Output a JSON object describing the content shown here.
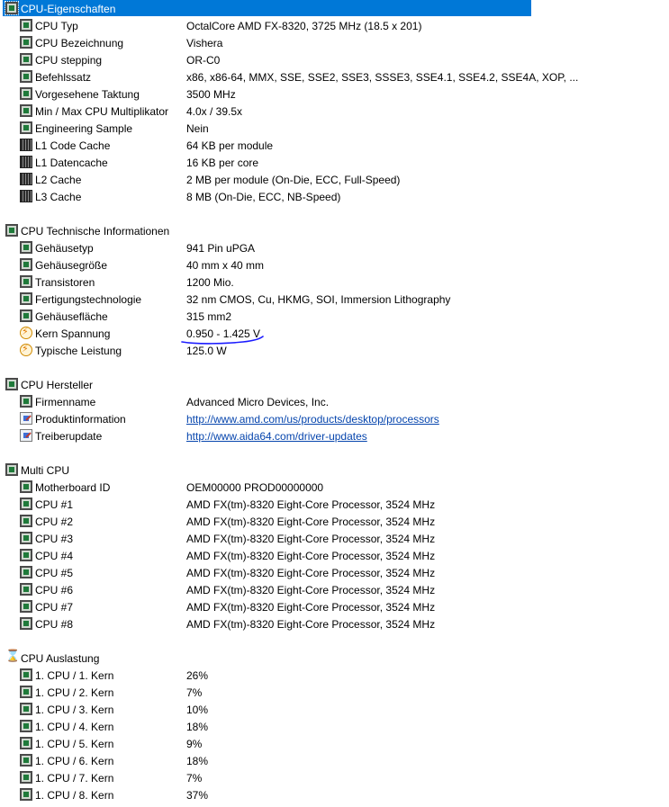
{
  "rows": [
    {
      "type": "section",
      "icon": "chip",
      "label": "CPU-Eigenschaften",
      "value": "",
      "selected": true,
      "name": "section-cpu-eigenschaften"
    },
    {
      "type": "item",
      "icon": "chip",
      "label": "CPU Typ",
      "value": "OctalCore AMD FX-8320, 3725 MHz (18.5 x 201)",
      "name": "row-cpu-typ"
    },
    {
      "type": "item",
      "icon": "chip",
      "label": "CPU Bezeichnung",
      "value": "Vishera",
      "name": "row-cpu-bezeichnung"
    },
    {
      "type": "item",
      "icon": "chip",
      "label": "CPU stepping",
      "value": "OR-C0",
      "name": "row-cpu-stepping"
    },
    {
      "type": "item",
      "icon": "chip",
      "label": "Befehlssatz",
      "value": "x86, x86-64, MMX, SSE, SSE2, SSE3, SSSE3, SSE4.1, SSE4.2, SSE4A, XOP, ...",
      "name": "row-befehlssatz"
    },
    {
      "type": "item",
      "icon": "chip",
      "label": "Vorgesehene Taktung",
      "value": "3500 MHz",
      "name": "row-vorgesehene-taktung"
    },
    {
      "type": "item",
      "icon": "chip",
      "label": "Min / Max CPU Multiplikator",
      "value": "4.0x / 39.5x",
      "name": "row-multiplikator"
    },
    {
      "type": "item",
      "icon": "chip",
      "label": "Engineering Sample",
      "value": "Nein",
      "name": "row-engineering-sample"
    },
    {
      "type": "item",
      "icon": "memory",
      "label": "L1 Code Cache",
      "value": "64 KB per module",
      "name": "row-l1-code-cache"
    },
    {
      "type": "item",
      "icon": "memory",
      "label": "L1 Datencache",
      "value": "16 KB per core",
      "name": "row-l1-datencache"
    },
    {
      "type": "item",
      "icon": "memory",
      "label": "L2 Cache",
      "value": "2 MB per module  (On-Die, ECC, Full-Speed)",
      "name": "row-l2-cache"
    },
    {
      "type": "item",
      "icon": "memory",
      "label": "L3 Cache",
      "value": "8 MB  (On-Die, ECC, NB-Speed)",
      "name": "row-l3-cache"
    },
    {
      "type": "blank"
    },
    {
      "type": "section",
      "icon": "chip",
      "label": "CPU Technische Informationen",
      "value": "",
      "name": "section-cpu-technische-informationen"
    },
    {
      "type": "item",
      "icon": "chip",
      "label": "Gehäusetyp",
      "value": "941 Pin uPGA",
      "name": "row-gehaeusetyp"
    },
    {
      "type": "item",
      "icon": "chip",
      "label": "Gehäusegröße",
      "value": "40 mm x 40 mm",
      "name": "row-gehaeusegroesse"
    },
    {
      "type": "item",
      "icon": "chip",
      "label": "Transistoren",
      "value": "1200 Mio.",
      "name": "row-transistoren"
    },
    {
      "type": "item",
      "icon": "chip",
      "label": "Fertigungstechnologie",
      "value": "32 nm CMOS, Cu, HKMG, SOI, Immersion Lithography",
      "name": "row-fertigungstechnologie"
    },
    {
      "type": "item",
      "icon": "chip",
      "label": "Gehäusefläche",
      "value": "315 mm2",
      "name": "row-gehaeuseflaeche"
    },
    {
      "type": "item",
      "icon": "bolt",
      "label": "Kern Spannung",
      "value": "0.950 - 1.425 V",
      "name": "row-kern-spannung"
    },
    {
      "type": "item",
      "icon": "bolt",
      "label": "Typische Leistung",
      "value": "125.0 W",
      "name": "row-typische-leistung"
    },
    {
      "type": "blank"
    },
    {
      "type": "section",
      "icon": "chip",
      "label": "CPU Hersteller",
      "value": "",
      "name": "section-cpu-hersteller"
    },
    {
      "type": "item",
      "icon": "chip",
      "label": "Firmenname",
      "value": "Advanced Micro Devices, Inc.",
      "name": "row-firmenname"
    },
    {
      "type": "item",
      "icon": "web",
      "label": "Produktinformation",
      "value": "http://www.amd.com/us/products/desktop/processors",
      "link": true,
      "name": "row-produktinformation"
    },
    {
      "type": "item",
      "icon": "web",
      "label": "Treiberupdate",
      "value": "http://www.aida64.com/driver-updates",
      "link": true,
      "name": "row-treiberupdate"
    },
    {
      "type": "blank"
    },
    {
      "type": "section",
      "icon": "chip",
      "label": "Multi CPU",
      "value": "",
      "name": "section-multi-cpu"
    },
    {
      "type": "item",
      "icon": "chip",
      "label": "Motherboard ID",
      "value": "OEM00000 PROD00000000",
      "name": "row-motherboard-id"
    },
    {
      "type": "item",
      "icon": "chip",
      "label": "CPU #1",
      "value": "AMD FX(tm)-8320 Eight-Core Processor, 3524 MHz",
      "name": "row-cpu-1"
    },
    {
      "type": "item",
      "icon": "chip",
      "label": "CPU #2",
      "value": "AMD FX(tm)-8320 Eight-Core Processor, 3524 MHz",
      "name": "row-cpu-2"
    },
    {
      "type": "item",
      "icon": "chip",
      "label": "CPU #3",
      "value": "AMD FX(tm)-8320 Eight-Core Processor, 3524 MHz",
      "name": "row-cpu-3"
    },
    {
      "type": "item",
      "icon": "chip",
      "label": "CPU #4",
      "value": "AMD FX(tm)-8320 Eight-Core Processor, 3524 MHz",
      "name": "row-cpu-4"
    },
    {
      "type": "item",
      "icon": "chip",
      "label": "CPU #5",
      "value": "AMD FX(tm)-8320 Eight-Core Processor, 3524 MHz",
      "name": "row-cpu-5"
    },
    {
      "type": "item",
      "icon": "chip",
      "label": "CPU #6",
      "value": "AMD FX(tm)-8320 Eight-Core Processor, 3524 MHz",
      "name": "row-cpu-6"
    },
    {
      "type": "item",
      "icon": "chip",
      "label": "CPU #7",
      "value": "AMD FX(tm)-8320 Eight-Core Processor, 3524 MHz",
      "name": "row-cpu-7"
    },
    {
      "type": "item",
      "icon": "chip",
      "label": "CPU #8",
      "value": "AMD FX(tm)-8320 Eight-Core Processor, 3524 MHz",
      "name": "row-cpu-8"
    },
    {
      "type": "blank"
    },
    {
      "type": "section",
      "icon": "hourglass",
      "label": "CPU Auslastung",
      "value": "",
      "name": "section-cpu-auslastung"
    },
    {
      "type": "item",
      "icon": "chip",
      "label": "1. CPU / 1. Kern",
      "value": "26%",
      "name": "row-kern-1"
    },
    {
      "type": "item",
      "icon": "chip",
      "label": "1. CPU / 2. Kern",
      "value": "7%",
      "name": "row-kern-2"
    },
    {
      "type": "item",
      "icon": "chip",
      "label": "1. CPU / 3. Kern",
      "value": "10%",
      "name": "row-kern-3"
    },
    {
      "type": "item",
      "icon": "chip",
      "label": "1. CPU / 4. Kern",
      "value": "18%",
      "name": "row-kern-4"
    },
    {
      "type": "item",
      "icon": "chip",
      "label": "1. CPU / 5. Kern",
      "value": "9%",
      "name": "row-kern-5"
    },
    {
      "type": "item",
      "icon": "chip",
      "label": "1. CPU / 6. Kern",
      "value": "18%",
      "name": "row-kern-6"
    },
    {
      "type": "item",
      "icon": "chip",
      "label": "1. CPU / 7. Kern",
      "value": "7%",
      "name": "row-kern-7"
    },
    {
      "type": "item",
      "icon": "chip",
      "label": "1. CPU / 8. Kern",
      "value": "37%",
      "name": "row-kern-8"
    }
  ],
  "colors": {
    "selection": "#0078d7",
    "link": "#0645ad",
    "annotation_underline": "#1a1aff"
  }
}
